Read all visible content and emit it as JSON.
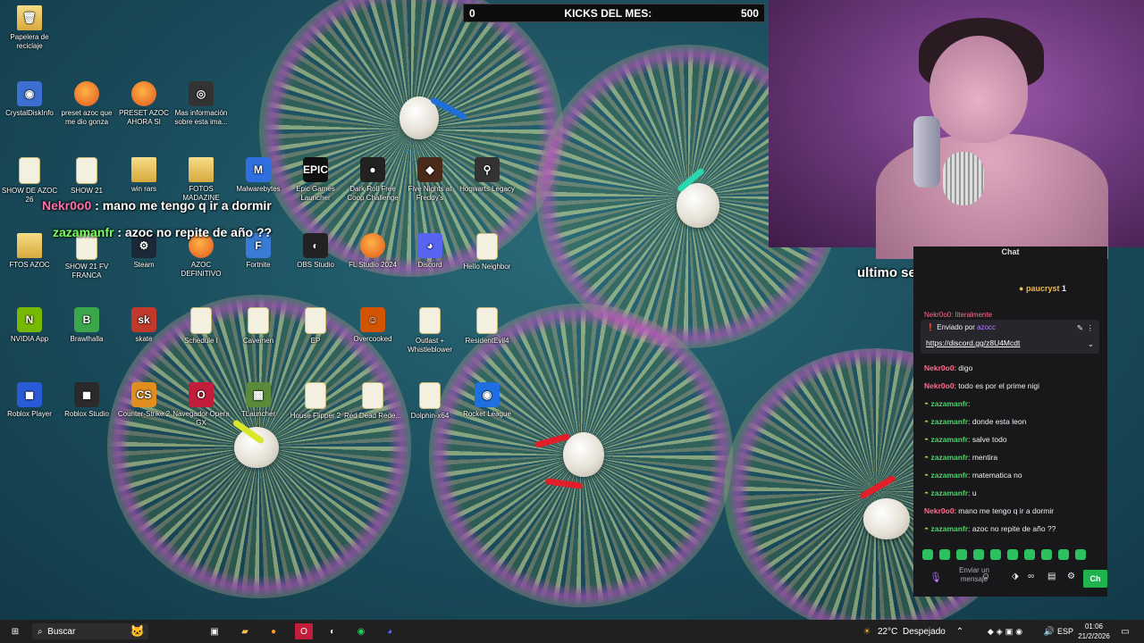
{
  "kicks_bar": {
    "left_value": "0",
    "title": "KICKS DEL MES:",
    "goal": "500"
  },
  "desktop_icons": [
    {
      "label": "Papelera de reciclaje",
      "glyph": "🗑",
      "style": "folder",
      "name": "recycle-bin-icon"
    },
    {
      "label": "CrystalDiskInfo",
      "glyph": "◉",
      "style": "plain",
      "name": "crystaldiskinfo-icon"
    },
    {
      "label": "preset azoc que me dio gonza",
      "glyph": "",
      "style": "fl",
      "name": "fl-studio-icon"
    },
    {
      "label": "PRESET AZOC AHORA SI",
      "glyph": "",
      "style": "fl",
      "name": "fl-studio-icon"
    },
    {
      "label": "Mas información sobre esta ima...",
      "glyph": "◎",
      "style": "plain",
      "name": "info-icon"
    },
    {
      "label": "SHOW DE AZOC 26",
      "glyph": "",
      "style": "doc",
      "name": "document-icon"
    },
    {
      "label": "SHOW 21",
      "glyph": "",
      "style": "doc",
      "name": "document-icon"
    },
    {
      "label": "win rars",
      "glyph": "",
      "style": "folder",
      "name": "winrar-icon"
    },
    {
      "label": "FOTOS MADAZINE",
      "glyph": "",
      "style": "folder",
      "name": "folder-icon"
    },
    {
      "label": "Malwarebytes",
      "glyph": "M",
      "style": "plain",
      "name": "malwarebytes-icon"
    },
    {
      "label": "Epic Games Launcher",
      "glyph": "EPIC",
      "style": "plain",
      "name": "epic-games-icon"
    },
    {
      "label": "Dark Roll Free Coop Challenge",
      "glyph": "●",
      "style": "plain",
      "name": "game-icon"
    },
    {
      "label": "Five Nights at Freddy's",
      "glyph": "◆",
      "style": "plain",
      "name": "game-icon"
    },
    {
      "label": "Hogwarts Legacy",
      "glyph": "⚲",
      "style": "plain",
      "name": "game-icon"
    },
    {
      "label": "FTOS AZOC",
      "glyph": "",
      "style": "folder",
      "name": "folder-icon"
    },
    {
      "label": "SHOW 21 FV FRANCA",
      "glyph": "",
      "style": "doc",
      "name": "document-icon"
    },
    {
      "label": "Steam",
      "glyph": "⚙",
      "style": "plain",
      "name": "steam-icon"
    },
    {
      "label": "AZOC DEFINITIVO",
      "glyph": "",
      "style": "fl",
      "name": "fl-studio-icon"
    },
    {
      "label": "Fortnite",
      "glyph": "F",
      "style": "plain",
      "name": "fortnite-icon"
    },
    {
      "label": "OBS Studio",
      "glyph": "◐",
      "style": "plain",
      "name": "obs-icon"
    },
    {
      "label": "FL Studio 2024",
      "glyph": "",
      "style": "fl",
      "name": "fl-studio-icon"
    },
    {
      "label": "Discord",
      "glyph": "◕",
      "style": "plain",
      "name": "discord-icon"
    },
    {
      "label": "Hello Neighbor",
      "glyph": "",
      "style": "doc",
      "name": "document-icon"
    },
    {
      "label": "NVIDIA App",
      "glyph": "N",
      "style": "plain",
      "name": "nvidia-icon"
    },
    {
      "label": "Brawlhalla",
      "glyph": "B",
      "style": "plain",
      "name": "brawlhalla-icon"
    },
    {
      "label": "skate",
      "glyph": "sk",
      "style": "plain",
      "name": "skate-icon"
    },
    {
      "label": "Schedule I",
      "glyph": "",
      "style": "doc",
      "name": "document-icon"
    },
    {
      "label": "Cavemen",
      "glyph": "",
      "style": "doc",
      "name": "document-icon"
    },
    {
      "label": "EP",
      "glyph": "",
      "style": "doc",
      "name": "document-icon"
    },
    {
      "label": "Overcooked",
      "glyph": "☺",
      "style": "plain",
      "name": "overcooked-icon"
    },
    {
      "label": "Outlast + Whistleblower",
      "glyph": "",
      "style": "doc",
      "name": "document-icon"
    },
    {
      "label": "ResidentEvil4",
      "glyph": "",
      "style": "doc",
      "name": "document-icon"
    },
    {
      "label": "Roblox Player",
      "glyph": "◼",
      "style": "plain",
      "name": "roblox-player-icon"
    },
    {
      "label": "Roblox Studio",
      "glyph": "◼",
      "style": "plain",
      "name": "roblox-studio-icon"
    },
    {
      "label": "Counter-Strike 2",
      "glyph": "CS",
      "style": "plain",
      "name": "counter-strike-icon"
    },
    {
      "label": "Navegador Opera GX",
      "glyph": "O",
      "style": "plain",
      "name": "opera-gx-icon"
    },
    {
      "label": "TLauncher",
      "glyph": "▩",
      "style": "plain",
      "name": "tlauncher-icon"
    },
    {
      "label": "House Flipper 2",
      "glyph": "",
      "style": "doc",
      "name": "document-icon"
    },
    {
      "label": "Red Dead Rede...",
      "glyph": "",
      "style": "doc",
      "name": "document-icon"
    },
    {
      "label": "Dolphin-x64",
      "glyph": "",
      "style": "doc",
      "name": "document-icon"
    },
    {
      "label": "Rocket League",
      "glyph": "◉",
      "style": "plain",
      "name": "rocket-league-icon"
    }
  ],
  "overlay_messages": [
    {
      "user": "Nekr0o0",
      "text": " : mano me tengo q ir a dormir",
      "color": "#ff6fa8"
    },
    {
      "user": "zazamanfr",
      "text": " : azoc no repite de año ??",
      "color": "#7bff5a"
    }
  ],
  "follower_banner": "ultimo seguidor: KrokaKoka",
  "chat": {
    "title": "Chat",
    "top_supporters": [
      {
        "name": "paucryst",
        "count": "1"
      }
    ],
    "pinned_by_label": "Enviado por",
    "pinned_by_user": "azocc",
    "pinned_link": "https://discord.gg/z8U4Mcdt",
    "partial_line": "Nekr0o0: literalmente",
    "messages": [
      {
        "user": "Nekr0o0",
        "text": "digo",
        "color": "#ff6b8b",
        "badge": false
      },
      {
        "user": "Nekr0o0",
        "text": "todo es por el prime nigi",
        "color": "#ff6b8b",
        "badge": false
      },
      {
        "user": "zazamanfr",
        "text": "",
        "color": "#4fd16b",
        "badge": true
      },
      {
        "user": "zazamanfr",
        "text": "donde esta leon",
        "color": "#4fd16b",
        "badge": true
      },
      {
        "user": "zazamanfr",
        "text": "salve todo",
        "color": "#4fd16b",
        "badge": true
      },
      {
        "user": "zazamanfr",
        "text": "mentira",
        "color": "#4fd16b",
        "badge": true
      },
      {
        "user": "zazamanfr",
        "text": "matematica no",
        "color": "#4fd16b",
        "badge": true
      },
      {
        "user": "zazamanfr",
        "text": "u",
        "color": "#4fd16b",
        "badge": true
      },
      {
        "user": "Nekr0o0",
        "text": "mano me tengo q ir a dormir",
        "color": "#ff6b8b",
        "badge": false
      },
      {
        "user": "zazamanfr",
        "text": "azoc no repite de año ??",
        "color": "#4fd16b",
        "badge": true
      }
    ],
    "input_placeholder": "Enviar un mensaje",
    "send_label": "Ch"
  },
  "taskbar": {
    "search_label": "Buscar",
    "weather": "22°C",
    "weather_desc": "Despejado",
    "lang": "ESP",
    "time": "01:06",
    "date": "21/2/2026"
  }
}
